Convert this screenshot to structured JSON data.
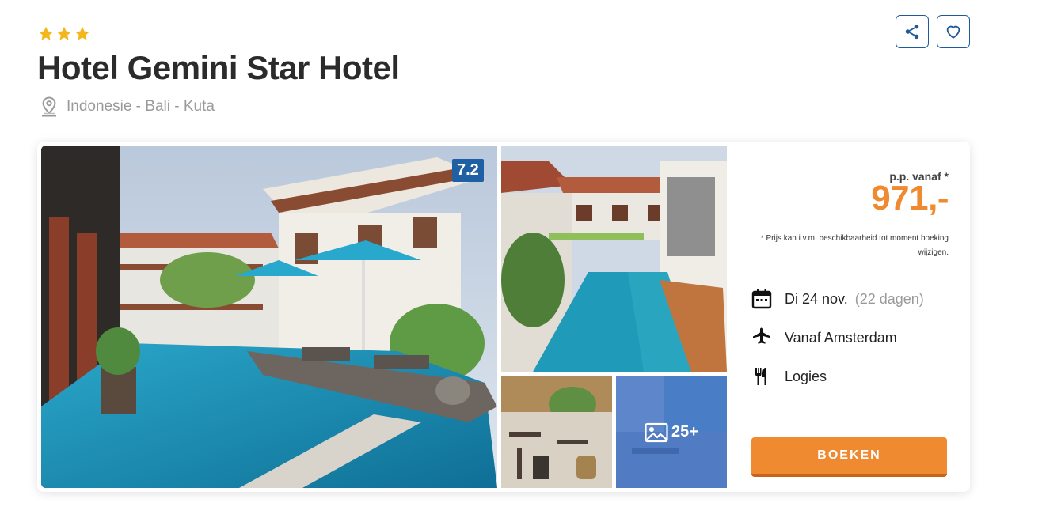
{
  "hotel": {
    "stars": 3,
    "name": "Hotel Gemini Star Hotel",
    "location": "Indonesie - Bali - Kuta"
  },
  "actions": {
    "share_icon": "share-icon",
    "favorite_icon": "heart-icon"
  },
  "gallery": {
    "rating": "7.2",
    "more_photos_label": "25+"
  },
  "pricing": {
    "from_label": "p.p. vanaf *",
    "price": "971,-",
    "disclaimer": "* Prijs kan i.v.m. beschikbaarheid tot moment boeking wijzigen."
  },
  "details": {
    "date": "Di 24 nov.",
    "days": "(22 dagen)",
    "departure": "Vanaf Amsterdam",
    "board": "Logies"
  },
  "book_button": "BOEKEN",
  "colors": {
    "accent": "#f08a30",
    "primary": "#1f5fa3",
    "star": "#f3b71c"
  }
}
